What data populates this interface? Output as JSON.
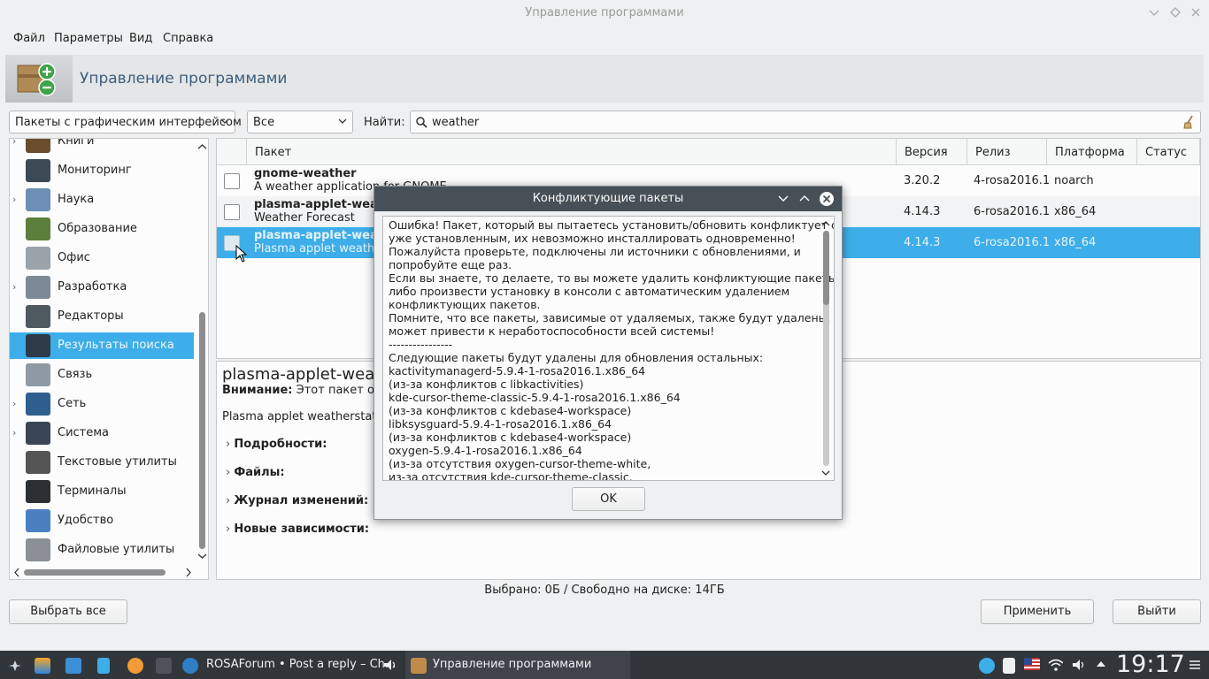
{
  "window": {
    "title": "Управление программами"
  },
  "menu": [
    "Файл",
    "Параметры",
    "Вид",
    "Справка"
  ],
  "header": {
    "app_name": "Управление программами"
  },
  "filters": {
    "package_type": "Пакеты с графическим интерфейсом",
    "status_filter": "Все",
    "find_label": "Найти:",
    "search_value": "weather"
  },
  "sidebar": {
    "items": [
      {
        "label": "Книги",
        "icon": "book-icon",
        "expandable": true
      },
      {
        "label": "Мониторинг",
        "icon": "monitor-graph-icon",
        "expandable": false
      },
      {
        "label": "Наука",
        "icon": "science-flask-icon",
        "expandable": true
      },
      {
        "label": "Образование",
        "icon": "chalkboard-icon",
        "expandable": false
      },
      {
        "label": "Офис",
        "icon": "office-icon",
        "expandable": false
      },
      {
        "label": "Разработка",
        "icon": "tools-icon",
        "expandable": true
      },
      {
        "label": "Редакторы",
        "icon": "editor-monitor-icon",
        "expandable": false
      },
      {
        "label": "Результаты поиска",
        "icon": "star-icon",
        "expandable": false,
        "selected": true
      },
      {
        "label": "Связь",
        "icon": "satellite-icon",
        "expandable": false
      },
      {
        "label": "Сеть",
        "icon": "network-globe-icon",
        "expandable": true
      },
      {
        "label": "Система",
        "icon": "system-star-icon",
        "expandable": true
      },
      {
        "label": "Текстовые утилиты",
        "icon": "pen-icon",
        "expandable": false
      },
      {
        "label": "Терминалы",
        "icon": "terminal-icon",
        "expandable": false
      },
      {
        "label": "Удобство",
        "icon": "accessibility-icon",
        "expandable": false
      },
      {
        "label": "Файловые утилиты",
        "icon": "file-utilities-icon",
        "expandable": false
      }
    ]
  },
  "table": {
    "columns": [
      "Пакет",
      "Версия",
      "Релиз",
      "Платформа",
      "Статус"
    ],
    "rows": [
      {
        "name": "gnome-weather",
        "summary": "A weather application for GNOME",
        "version": "3.20.2",
        "release": "4-rosa2016.1",
        "platform": "noarch",
        "status": ""
      },
      {
        "name": "plasma-applet-weather",
        "summary": "Weather Forecast",
        "version": "4.14.3",
        "release": "6-rosa2016.1",
        "platform": "x86_64",
        "status": ""
      },
      {
        "name": "plasma-applet-weatherstation",
        "summary": "Plasma applet weatherstation",
        "version": "4.14.3",
        "release": "6-rosa2016.1",
        "platform": "x86_64",
        "status": ""
      }
    ]
  },
  "details": {
    "title": "plasma-applet-weatherstation",
    "warning_label": "Внимание:",
    "warning_text": "Этот пакет официально не поддерживается",
    "description": "Plasma applet weatherstation",
    "sections": [
      "Подробности:",
      "Файлы:",
      "Журнал изменений:",
      "Новые зависимости:"
    ]
  },
  "status_line": "Выбрано: 0Б / Свободно на диске: 14ГБ",
  "buttons": {
    "select_all": "Выбрать все",
    "apply": "Применить",
    "quit": "Выйти"
  },
  "dialog": {
    "title": "Конфликтующие пакеты",
    "lines": [
      "Ошибка! Пакет, который вы пытаетесь установить/обновить конфликтует с",
      "уже установленным, их невозможно инсталлировать одновременно!",
      "Пожалуйста проверьте, подключены ли источники с обновлениями, и",
      "попробуйте еще раз.",
      "Если вы знаете, то делаете, то вы можете удалить конфликтующие пакеты",
      "либо произвести установку в консоли с автоматическим удалением",
      "конфликтующих пакетов.",
      "Помните, что все пакеты, зависимые от удаляемых, также будут удалены. Это",
      "может привести к неработоспособности всей системы!",
      "----------------",
      "Следующие пакеты будут удалены для обновления остальных:",
      "kactivitymanagerd-5.9.4-1-rosa2016.1.x86_64",
      " (из-за конфликтов с libkactivities)",
      "kde-cursor-theme-classic-5.9.4-1-rosa2016.1.x86_64",
      " (из-за конфликтов с kdebase4-workspace)",
      "libksysguard-5.9.4-1-rosa2016.1.x86_64",
      " (из-за конфликтов с kdebase4-workspace)",
      "oxygen-5.9.4-1-rosa2016.1.x86_64",
      " (из-за отсутствия oxygen-cursor-theme-white,",
      "  из-за отсутствия kde-cursor-theme-classic,"
    ],
    "ok_label": "OK"
  },
  "taskbar": {
    "tasks": [
      {
        "label": "ROSAForum • Post a reply – Ch...",
        "icon": "browser-icon"
      },
      {
        "label": "Управление программами",
        "icon": "package-manager-icon"
      }
    ],
    "clock": "19:17"
  }
}
